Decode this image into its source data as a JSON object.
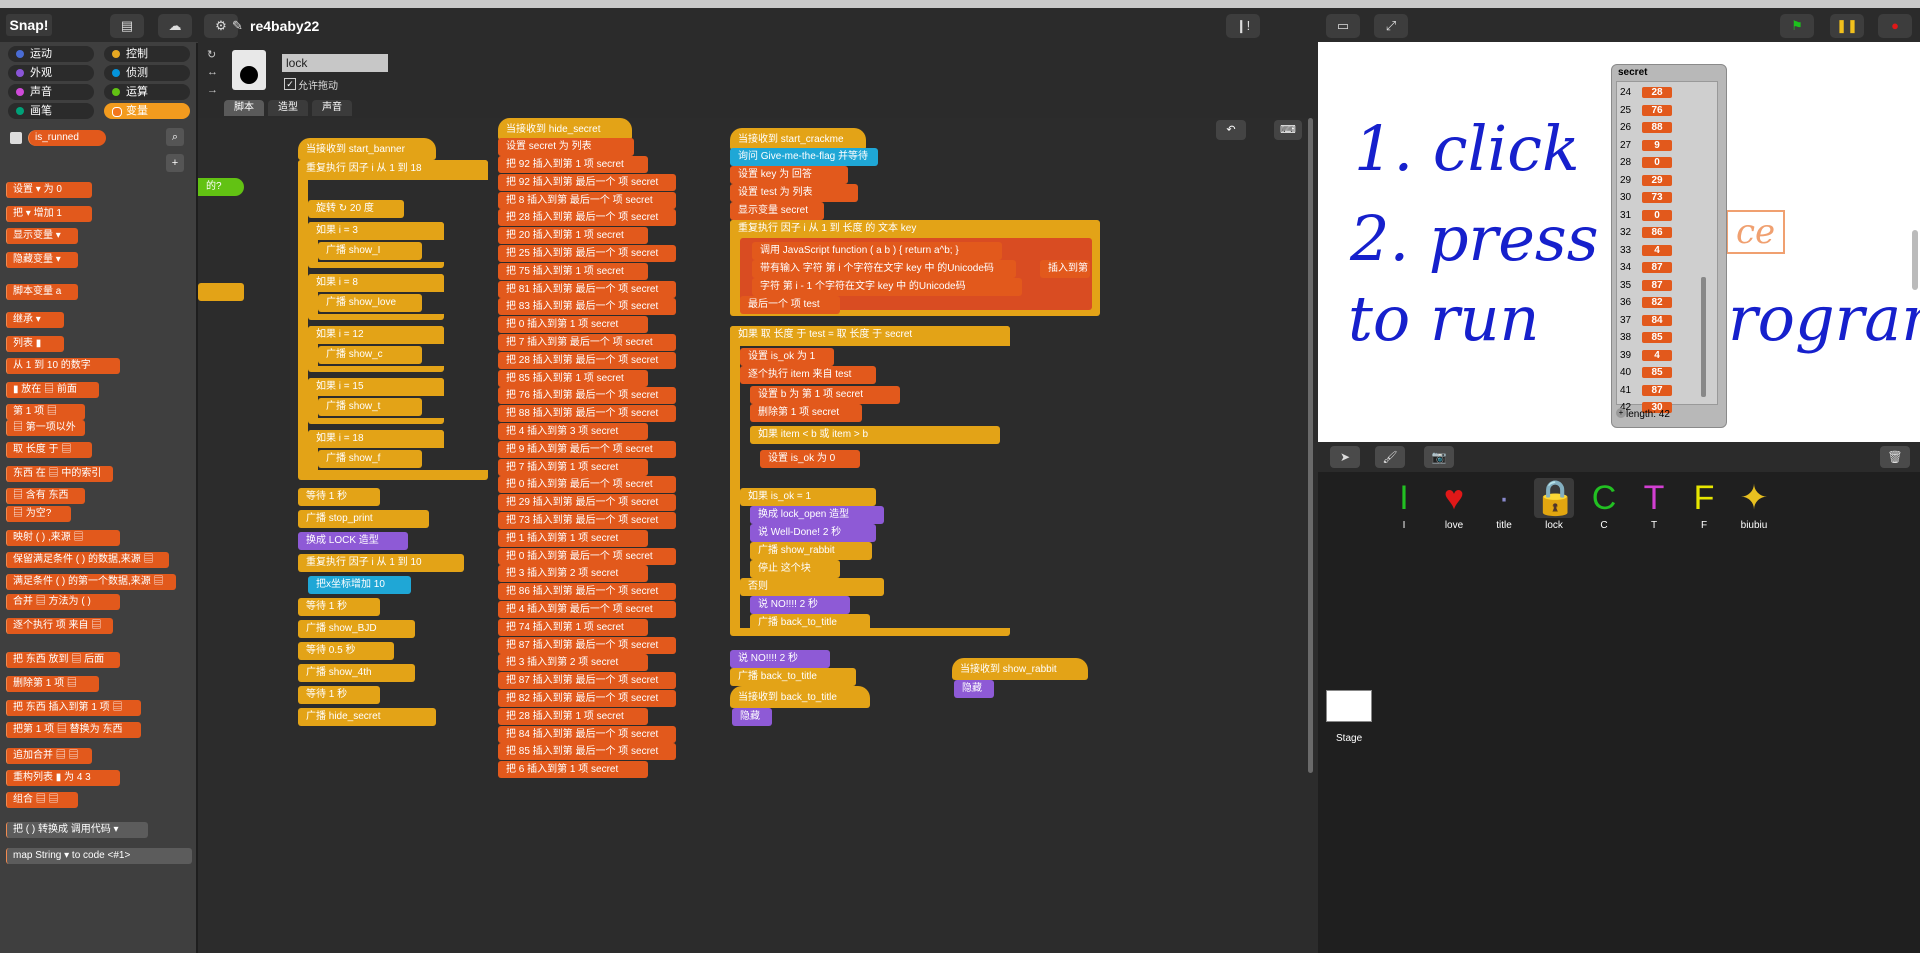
{
  "app": {
    "logo": "Snap!",
    "project_name": "re4baby22",
    "sprite_name": "lock",
    "drag_label": "允许拖动"
  },
  "categories": [
    {
      "label": "运动",
      "color": "#4a6cd4"
    },
    {
      "label": "控制",
      "color": "#e6a822"
    },
    {
      "label": "外观",
      "color": "#8a55d7"
    },
    {
      "label": "侦测",
      "color": "#0494dc"
    },
    {
      "label": "声音",
      "color": "#cf4ad9"
    },
    {
      "label": "运算",
      "color": "#62c213"
    },
    {
      "label": "画笔",
      "color": "#00a178"
    },
    {
      "label": "变量",
      "color": "#f3761d"
    }
  ],
  "palette_blocks": [
    "is_runned",
    "设置 ▾ 为 0",
    "把 ▾ 增加 1",
    "显示变量 ▾",
    "隐藏变量 ▾",
    "脚本变量 a",
    "继承 ▾",
    "列表 ▮",
    "从 1 到 10 的数字",
    "▮ 放在 ▤ 前面",
    "第 1 项 ▤",
    "▤ 第一项以外",
    "取 长度 于 ▤",
    "东西 在 ▤ 中的索引",
    "▤ 含有 东西",
    "▤ 为空?",
    "映射 ( ) ,来源 ▤",
    "保留满足条件 ( ) 的数据,来源 ▤",
    "满足条件 ( ) 的第一个数据,来源 ▤",
    "合并 ▤ 方法为 ( )",
    "逐个执行 项 来自 ▤",
    "把 东西 放到 ▤ 后面",
    "删除第 1 项 ▤",
    "把 东西 插入到第 1 项 ▤",
    "把第 1 项 ▤ 替换为 东西",
    "追加合并 ▤ ▤",
    "重构列表 ▮ 为 4 3",
    "组合 ▤ ▤",
    "把 ( ) 转换成 调用代码 ▾",
    "map String ▾ to code <#1>"
  ],
  "tabs": [
    "脚本",
    "造型",
    "声音"
  ],
  "scripts": {
    "col1": {
      "hat": "当接收到 start_banner",
      "repeat_label": "重复执行 因子 i 从 1 到 18",
      "turn": "旋转 ↻ 20 度",
      "ifs": [
        {
          "cond": "i = 3",
          "broadcast": "广播 show_I"
        },
        {
          "cond": "i = 8",
          "broadcast": "广播 show_love"
        },
        {
          "cond": "i = 12",
          "broadcast": "广播 show_c"
        },
        {
          "cond": "i = 15",
          "broadcast": "广播 show_t"
        },
        {
          "cond": "i = 18",
          "broadcast": "广播 show_f"
        }
      ],
      "tail": [
        "等待 1 秒",
        "广播 stop_print",
        "换成 LOCK 造型",
        "重复执行 因子 i 从 1 到 10",
        "把x坐标增加 10",
        "等待 1 秒",
        "广播 show_BJD",
        "等待 0.5 秒",
        "广播 show_4th",
        "等待 1 秒",
        "广播 hide_secret"
      ]
    },
    "col2": {
      "hat": "当接收到 hide_secret",
      "set": "设置 secret 为 列表",
      "items": [
        "把 92 插入到第 1 项 secret",
        "把 92 插入到第 最后一个 项 secret",
        "把 8 插入到第 最后一个 项 secret",
        "把 28 插入到第 最后一个 项 secret",
        "把 20 插入到第 1 项 secret",
        "把 25 插入到第 最后一个 项 secret",
        "把 75 插入到第 1 项 secret",
        "把 81 插入到第 最后一个 项 secret",
        "把 83 插入到第 最后一个 项 secret",
        "把 0 插入到第 1 项 secret",
        "把 7 插入到第 最后一个 项 secret",
        "把 28 插入到第 最后一个 项 secret",
        "把 85 插入到第 1 项 secret",
        "把 76 插入到第 最后一个 项 secret",
        "把 88 插入到第 最后一个 项 secret",
        "把 4 插入到第 3 项 secret",
        "把 9 插入到第 最后一个 项 secret",
        "把 7 插入到第 1 项 secret",
        "把 0 插入到第 最后一个 项 secret",
        "把 29 插入到第 最后一个 项 secret",
        "把 73 插入到第 最后一个 项 secret",
        "把 1 插入到第 1 项 secret",
        "把 0 插入到第 最后一个 项 secret",
        "把 3 插入到第 2 项 secret",
        "把 86 插入到第 最后一个 项 secret",
        "把 4 插入到第 最后一个 项 secret",
        "把 74 插入到第 1 项 secret",
        "把 87 插入到第 最后一个 项 secret",
        "把 3 插入到第 2 项 secret",
        "把 87 插入到第 最后一个 项 secret",
        "把 82 插入到第 最后一个 项 secret",
        "把 28 插入到第 1 项 secret",
        "把 84 插入到第 最后一个 项 secret",
        "把 85 插入到第 最后一个 项 secret",
        "把 6 插入到第 1 项 secret"
      ]
    },
    "col3": {
      "hat": "当接收到 start_crackme",
      "ask": "询问 Give-me-the-flag 并等待",
      "set_key": "设置 key 为 回答",
      "set_test": "设置 test 为 列表",
      "show_secret": "显示变量 secret",
      "repeat": "重复执行 因子 i 从 1 到 长度 的 文本 key",
      "call": "调用 JavaScript function ( a b ) { return a^b; }",
      "with_inputs": "带有输入 字符 第 i 个字符在文字 key 中 的Unicode码",
      "char_line": "字符 第 i - 1 个字符在文字 key 中 的Unicode码",
      "insert_label": "插入到第",
      "last_item": "最后一个 项 test",
      "if_len": "如果 取 长度 于 test = 取 长度 于 secret",
      "set_ok1": "设置 is_ok 为 1",
      "foreach": "逐个执行 item 来自 test",
      "set_b": "设置 b 为 第 1 项 secret",
      "delete": "删除第 1 项 secret",
      "if_cmp": "如果 item < b 或 item > b",
      "set_ok0": "设置 is_ok 为 0",
      "if_ok": "如果 is_ok = 1",
      "switch": "换成 lock_open 造型",
      "say_done": "说 Well-Done! 2 秒",
      "bc_rabbit": "广播 show_rabbit",
      "stop": "停止 这个块",
      "else": "否则",
      "say_no": "说 NO!!!! 2 秒",
      "bc_title": "广播 back_to_title",
      "say_no2": "说 NO!!!! 2 秒",
      "bc_title2": "广播 back_to_title",
      "hat2": "当接收到 back_to_title",
      "hide2": "隐藏",
      "hat3": "当接收到 show_rabbit",
      "hide3": "隐藏"
    }
  },
  "stage": {
    "line1": "1. click",
    "line2": "2. press",
    "line3": "to run ",
    "line3b": "rogram",
    "ghost": "ce"
  },
  "watcher": {
    "title": "secret",
    "rows": [
      [
        "24",
        "28"
      ],
      [
        "25",
        "76"
      ],
      [
        "26",
        "88"
      ],
      [
        "27",
        "9"
      ],
      [
        "28",
        "0"
      ],
      [
        "29",
        "29"
      ],
      [
        "30",
        "73"
      ],
      [
        "31",
        "0"
      ],
      [
        "32",
        "86"
      ],
      [
        "33",
        "4"
      ],
      [
        "34",
        "87"
      ],
      [
        "35",
        "87"
      ],
      [
        "36",
        "82"
      ],
      [
        "37",
        "84"
      ],
      [
        "38",
        "85"
      ],
      [
        "39",
        "4"
      ],
      [
        "40",
        "85"
      ],
      [
        "41",
        "87"
      ],
      [
        "42",
        "30"
      ]
    ],
    "length": "length: 42"
  },
  "sprites": [
    {
      "name": "I",
      "glyph": "I",
      "color": "#22c022"
    },
    {
      "name": "love",
      "glyph": "♥",
      "color": "#e01818"
    },
    {
      "name": "title",
      "glyph": "·",
      "color": "#8888cc"
    },
    {
      "name": "lock",
      "glyph": "🔒",
      "color": "#222222"
    },
    {
      "name": "C",
      "glyph": "C",
      "color": "#22c022"
    },
    {
      "name": "T",
      "glyph": "T",
      "color": "#d23fd2"
    },
    {
      "name": "F",
      "glyph": "F",
      "color": "#e6e600"
    },
    {
      "name": "biubiu",
      "glyph": "✦",
      "color": "#e8c020"
    }
  ],
  "stage_label": "Stage",
  "col1_partial": "的?"
}
